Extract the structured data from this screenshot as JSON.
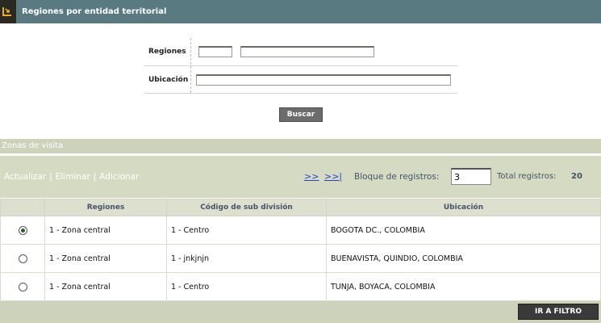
{
  "header": {
    "title": "Regiones por entidad territorial",
    "icon": "sort-icon"
  },
  "form": {
    "regiones_label": "Regiones",
    "regiones_code_value": "",
    "regiones_name_value": "",
    "ubicacion_label": "Ubicación",
    "ubicacion_value": "",
    "search_button": "Buscar"
  },
  "zonas": {
    "title": "Zonas de visita",
    "actions": [
      "Actualizar",
      "Eliminar",
      "Adicionar"
    ],
    "nav_next": ">>",
    "nav_last": ">>|",
    "block_label": "Bloque de registros:",
    "block_value": "3",
    "total_label": "Total registros:",
    "total_value": "20"
  },
  "table": {
    "columns": [
      "",
      "Regiones",
      "Código de sub división",
      "Ubicación"
    ],
    "rows": [
      {
        "selected": true,
        "region": "1 - Zona central",
        "subdivision": "1 - Centro",
        "ubicacion": "BOGOTA DC., COLOMBIA"
      },
      {
        "selected": false,
        "region": "1 - Zona central",
        "subdivision": "1 - jnkjnjn",
        "ubicacion": "BUENAVISTA, QUINDIO, COLOMBIA"
      },
      {
        "selected": false,
        "region": "1 - Zona central",
        "subdivision": "1 - Centro",
        "ubicacion": "TUNJA, BOYACA, COLOMBIA"
      }
    ]
  },
  "footer": {
    "filter_button": "IR A FILTRO"
  },
  "colors": {
    "title_bar": "#5a7a81",
    "section_bg": "#d5dac2",
    "link": "#2244cc"
  }
}
